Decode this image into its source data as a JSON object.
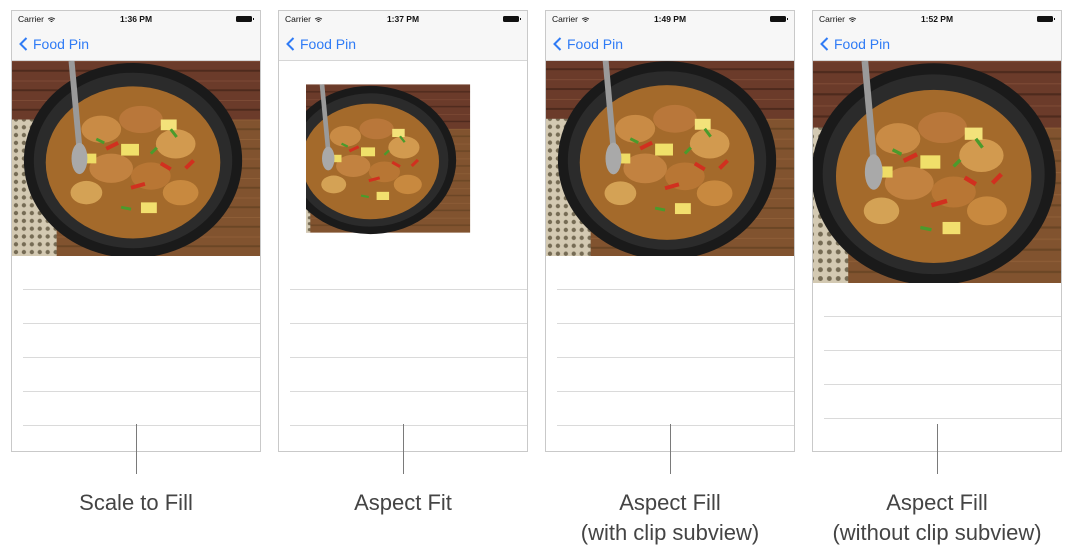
{
  "screens": [
    {
      "status": {
        "carrier": "Carrier",
        "time": "1:36 PM"
      },
      "nav": {
        "back_label": "Food Pin"
      },
      "mode": "scale-to-fill",
      "caption_line1": "Scale to Fill",
      "caption_line2": ""
    },
    {
      "status": {
        "carrier": "Carrier",
        "time": "1:37 PM"
      },
      "nav": {
        "back_label": "Food Pin"
      },
      "mode": "aspect-fit",
      "caption_line1": "Aspect Fit",
      "caption_line2": ""
    },
    {
      "status": {
        "carrier": "Carrier",
        "time": "1:49 PM"
      },
      "nav": {
        "back_label": "Food Pin"
      },
      "mode": "aspect-fill-clipped",
      "caption_line1": "Aspect Fill",
      "caption_line2": "(with clip subview)"
    },
    {
      "status": {
        "carrier": "Carrier",
        "time": "1:52 PM"
      },
      "nav": {
        "back_label": "Food Pin"
      },
      "mode": "aspect-fill-unclipped",
      "caption_line1": "Aspect Fill",
      "caption_line2": "(without clip subview)"
    }
  ],
  "icons": {
    "back": "chevron-left-icon",
    "wifi": "wifi-icon",
    "battery": "battery-icon"
  },
  "colors": {
    "accent": "#2f7bf5",
    "separator": "#dadada",
    "caption": "#444444"
  }
}
